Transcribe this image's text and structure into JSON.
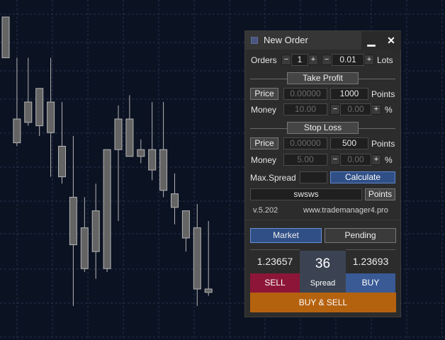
{
  "window": {
    "title": "New Order",
    "minimize_icon": "minimize-icon",
    "close_icon": "close-icon"
  },
  "orders": {
    "label": "Orders",
    "count": "1",
    "lots_value": "0.01",
    "lots_label": "Lots"
  },
  "take_profit": {
    "header": "Take Profit",
    "price_button": "Price",
    "price_value": "0.00000",
    "points_value": "1000",
    "points_label": "Points",
    "money_label": "Money",
    "money_value": "10.00",
    "percent_value": "0.00",
    "percent_label": "%"
  },
  "stop_loss": {
    "header": "Stop Loss",
    "price_button": "Price",
    "price_value": "0.00000",
    "points_value": "500",
    "points_label": "Points",
    "money_label": "Money",
    "money_value": "5.00",
    "percent_value": "0.00",
    "percent_label": "%"
  },
  "spread_row": {
    "label": "Max.Spread",
    "value": "",
    "calculate_button": "Calculate"
  },
  "comment_row": {
    "value": "swsws",
    "points_button": "Points"
  },
  "footer": {
    "version": "v.5.202",
    "website": "www.trademanager4.pro"
  },
  "tabs": {
    "market": "Market",
    "pending": "Pending"
  },
  "quotes": {
    "bid": "1.23657",
    "ask": "1.23693",
    "spread_value": "36",
    "spread_label": "Spread"
  },
  "actions": {
    "sell": "SELL",
    "buy": "BUY",
    "buy_and_sell": "BUY & SELL"
  },
  "stepper": {
    "minus": "−",
    "plus": "+"
  },
  "colors": {
    "chart_background": "#0b1222",
    "grid": "#24324d",
    "candle_fill": "#646464",
    "candle_border": "#b4b4b4",
    "sell": "#8c1538",
    "buy": "#3a5a96",
    "buy_and_sell": "#b5620f",
    "accent_blue": "#2f4f86"
  },
  "chart_data": {
    "type": "candlestick",
    "candles": [
      {
        "open": 0.17,
        "high": 0.1,
        "close": 0.05,
        "low": 0.17
      },
      {
        "open": 0.42,
        "high": 0.17,
        "close": 0.35,
        "low": 0.43
      },
      {
        "open": 0.3,
        "high": 0.17,
        "close": 0.36,
        "low": 0.37
      },
      {
        "open": 0.37,
        "high": 0.26,
        "close": 0.26,
        "low": 0.4
      },
      {
        "open": 0.39,
        "high": 0.17,
        "close": 0.3,
        "low": 0.52
      },
      {
        "open": 0.52,
        "high": 0.3,
        "close": 0.43,
        "low": 0.54
      },
      {
        "open": 0.72,
        "high": 0.4,
        "close": 0.58,
        "low": 0.9
      },
      {
        "open": 0.67,
        "high": 0.58,
        "close": 0.79,
        "low": 0.8
      },
      {
        "open": 0.62,
        "high": 0.54,
        "close": 0.74,
        "low": 0.82
      },
      {
        "open": 0.79,
        "high": 0.56,
        "close": 0.44,
        "low": 0.8
      },
      {
        "open": 0.44,
        "high": 0.31,
        "close": 0.35,
        "low": 0.65
      },
      {
        "open": 0.35,
        "high": 0.28,
        "close": 0.46,
        "low": 0.44
      },
      {
        "open": 0.46,
        "high": 0.41,
        "close": 0.44,
        "low": 0.48
      },
      {
        "open": 0.44,
        "high": 0.3,
        "close": 0.5,
        "low": 0.53
      },
      {
        "open": 0.56,
        "high": 0.3,
        "close": 0.44,
        "low": 0.58
      },
      {
        "open": 0.61,
        "high": 0.51,
        "close": 0.57,
        "low": 0.66
      },
      {
        "open": 0.7,
        "high": 0.63,
        "close": 0.62,
        "low": 0.74
      },
      {
        "open": 0.67,
        "high": 0.6,
        "close": 0.85,
        "low": 0.9
      },
      {
        "open": 0.86,
        "high": 0.65,
        "close": 0.85,
        "low": 0.87
      }
    ]
  }
}
